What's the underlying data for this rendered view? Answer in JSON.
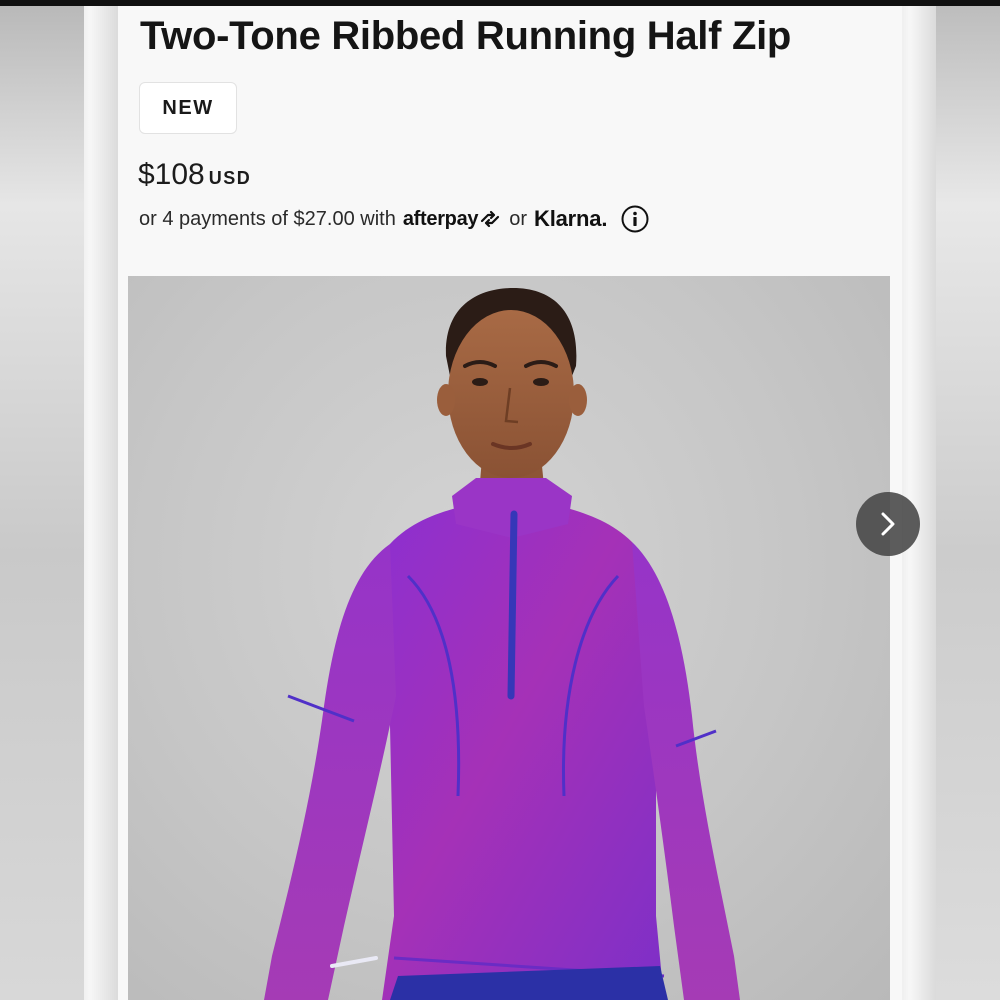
{
  "product": {
    "title": "Two-Tone Ribbed Running Half Zip",
    "badge": "NEW",
    "price": "$108",
    "currency": "USD"
  },
  "payments": {
    "prefix": "or 4 payments of $27.00 with",
    "provider_1": "afterpay",
    "separator": "or",
    "provider_2": "Klarna."
  },
  "icons": {
    "afterpay_logo_arrow": "afterpay-arrows-icon",
    "info": "info-icon",
    "next": "chevron-right-icon"
  },
  "colors": {
    "garment_primary": "#9a2fbf",
    "garment_secondary": "#3b3fc4",
    "image_background": "#c8c8c8"
  }
}
